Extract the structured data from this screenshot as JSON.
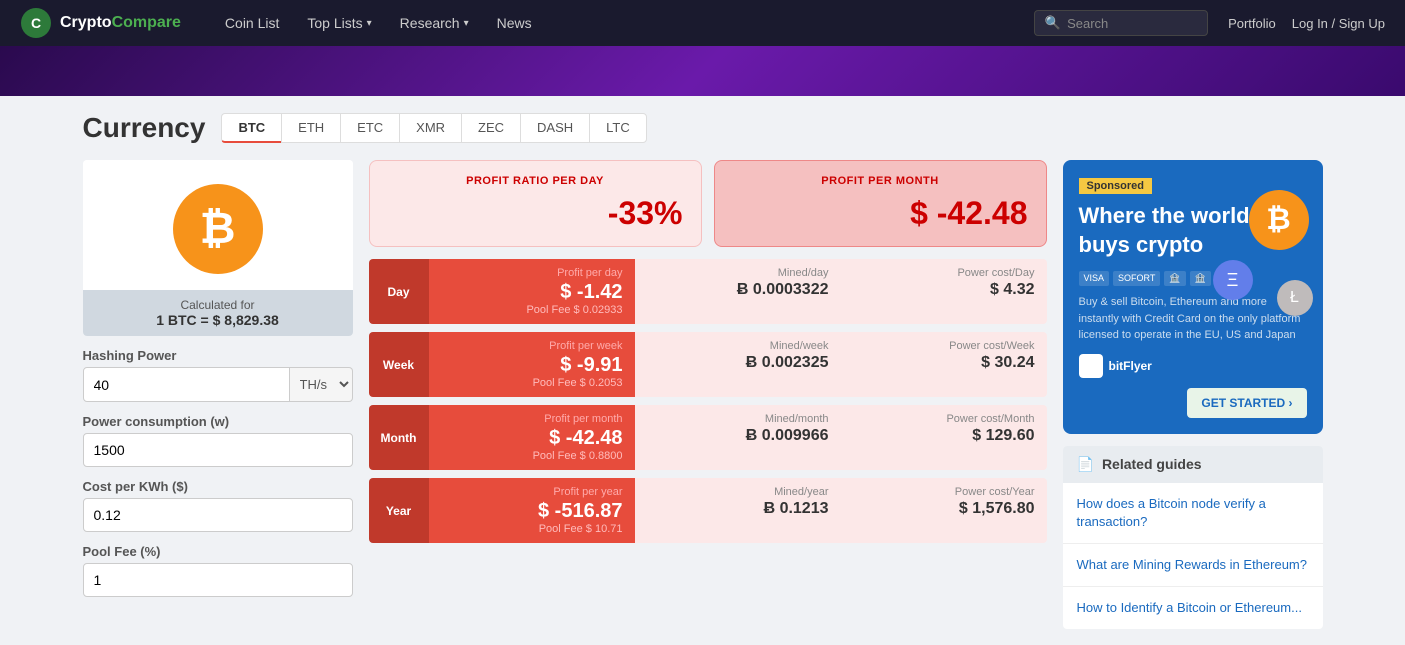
{
  "navbar": {
    "logo_text_crypto": "Crypto",
    "logo_text_compare": "Compare",
    "links": [
      {
        "id": "coin-list",
        "label": "Coin List",
        "has_dropdown": false
      },
      {
        "id": "top-lists",
        "label": "Top Lists",
        "has_dropdown": true
      },
      {
        "id": "research",
        "label": "Research",
        "has_dropdown": true
      },
      {
        "id": "news",
        "label": "News",
        "has_dropdown": false
      }
    ],
    "search_placeholder": "Search",
    "portfolio_label": "Portfolio",
    "login_label": "Log In / Sign Up"
  },
  "currency": {
    "title": "Currency",
    "tabs": [
      {
        "id": "btc",
        "label": "BTC",
        "active": true
      },
      {
        "id": "eth",
        "label": "ETH",
        "active": false
      },
      {
        "id": "etc",
        "label": "ETC",
        "active": false
      },
      {
        "id": "xmr",
        "label": "XMR",
        "active": false
      },
      {
        "id": "zec",
        "label": "ZEC",
        "active": false
      },
      {
        "id": "dash",
        "label": "DASH",
        "active": false
      },
      {
        "id": "ltc",
        "label": "LTC",
        "active": false
      }
    ]
  },
  "coin": {
    "symbol": "₿",
    "calc_for_label": "Calculated for",
    "calc_for_value": "1 BTC = $ 8,829.38"
  },
  "inputs": {
    "hashing_power_label": "Hashing Power",
    "hashing_power_value": "40",
    "hashing_power_unit": "TH/s",
    "power_consumption_label": "Power consumption (w)",
    "power_consumption_value": "1500",
    "cost_per_kwh_label": "Cost per KWh ($)",
    "cost_per_kwh_value": "0.12",
    "pool_fee_label": "Pool Fee (%)",
    "pool_fee_value": "1"
  },
  "profit_summary": {
    "day_label": "PROFIT RATIO PER DAY",
    "day_value": "-33%",
    "month_label": "PROFIT PER MONTH",
    "month_value": "$ -42.48"
  },
  "stats": [
    {
      "period": "Day",
      "profit_label": "Profit per day",
      "profit_value": "$ -1.42",
      "pool_fee": "Pool Fee $ 0.02933",
      "mined_label": "Mined/day",
      "mined_value": "Ƀ 0.0003322",
      "power_label": "Power cost/Day",
      "power_value": "$ 4.32"
    },
    {
      "period": "Week",
      "profit_label": "Profit per week",
      "profit_value": "$ -9.91",
      "pool_fee": "Pool Fee $ 0.2053",
      "mined_label": "Mined/week",
      "mined_value": "Ƀ 0.002325",
      "power_label": "Power cost/Week",
      "power_value": "$ 30.24"
    },
    {
      "period": "Month",
      "profit_label": "Profit per month",
      "profit_value": "$ -42.48",
      "pool_fee": "Pool Fee $ 0.8800",
      "mined_label": "Mined/month",
      "mined_value": "Ƀ 0.009966",
      "power_label": "Power cost/Month",
      "power_value": "$ 129.60"
    },
    {
      "period": "Year",
      "profit_label": "Profit per year",
      "profit_value": "$ -516.87",
      "pool_fee": "Pool Fee $ 10.71",
      "mined_label": "Mined/year",
      "mined_value": "Ƀ 0.1213",
      "power_label": "Power cost/Year",
      "power_value": "$ 1,576.80"
    }
  ],
  "ad": {
    "sponsored_label": "Sponsored",
    "headline": "Where the world buys crypto",
    "body_text": "Buy & sell Bitcoin, Ethereum and more instantly with Credit Card on the only platform licensed to operate in the EU, US and Japan",
    "brand_name": "bitFlyer",
    "cta_label": "GET STARTED ›",
    "payment_icons": [
      "VISA",
      "SOFORT",
      "bank1",
      "bank2"
    ]
  },
  "related_guides": {
    "header": "Related guides",
    "links": [
      {
        "id": "guide-1",
        "label": "How does a Bitcoin node verify a transaction?"
      },
      {
        "id": "guide-2",
        "label": "What are Mining Rewards in Ethereum?"
      },
      {
        "id": "guide-3",
        "label": "How to Identify a Bitcoin or Ethereum..."
      }
    ]
  }
}
